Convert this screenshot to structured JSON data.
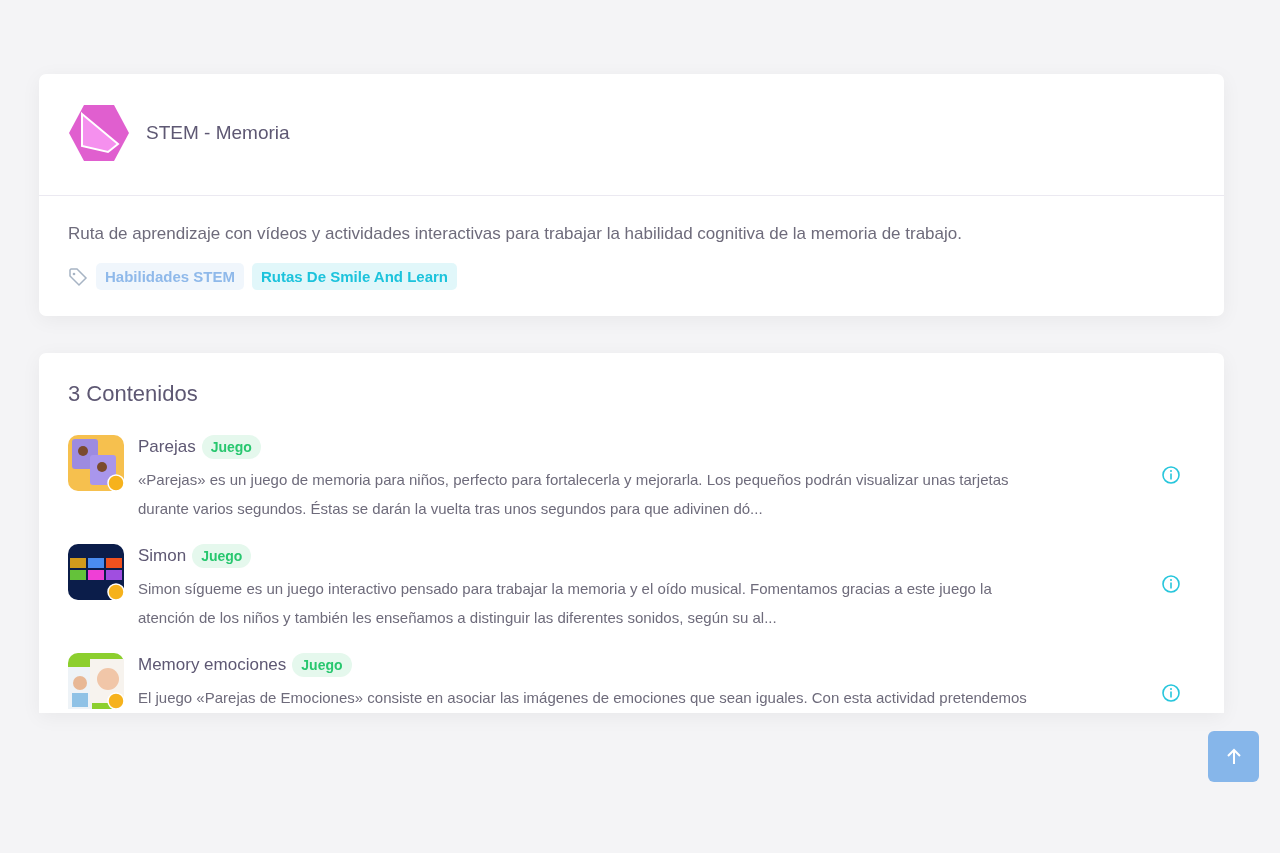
{
  "route": {
    "title": "STEM - Memoria",
    "description": "Ruta de aprendizaje con vídeos y actividades interactivas para trabajar la habilidad cognitiva de la memoria de trabajo.",
    "tags": [
      {
        "label": "Habilidades STEM",
        "color": "#8fb9ea"
      },
      {
        "label": "Rutas De Smile And Learn",
        "color": "#1cc3dc"
      }
    ]
  },
  "contents": {
    "heading": "3 Contenidos",
    "items": [
      {
        "title": "Parejas",
        "badge": "Juego",
        "lines": [
          "«Parejas» es un juego de memoria para niños, perfecto para fortalecerla y mejorarla. Los pequeños podrán visualizar unas tarjetas",
          "durante varios segundos. Éstas se darán la vuelta tras unos segundos para que adivinen dó..."
        ],
        "kind": "cards"
      },
      {
        "title": "Simon",
        "badge": "Juego",
        "lines": [
          "Simon sígueme es un juego interactivo pensado para trabajar la memoria y el oído musical. Fomentamos gracias a este juego la",
          "atención de los niños y también les enseñamos a distinguir las diferentes sonidos, según su al..."
        ],
        "kind": "pads"
      },
      {
        "title": "Memory emociones",
        "badge": "Juego",
        "lines": [
          "El juego «Parejas de Emociones» consiste en asociar las imágenes de emociones que sean iguales. Con esta actividad pretendemos"
        ],
        "kind": "faces"
      }
    ]
  }
}
